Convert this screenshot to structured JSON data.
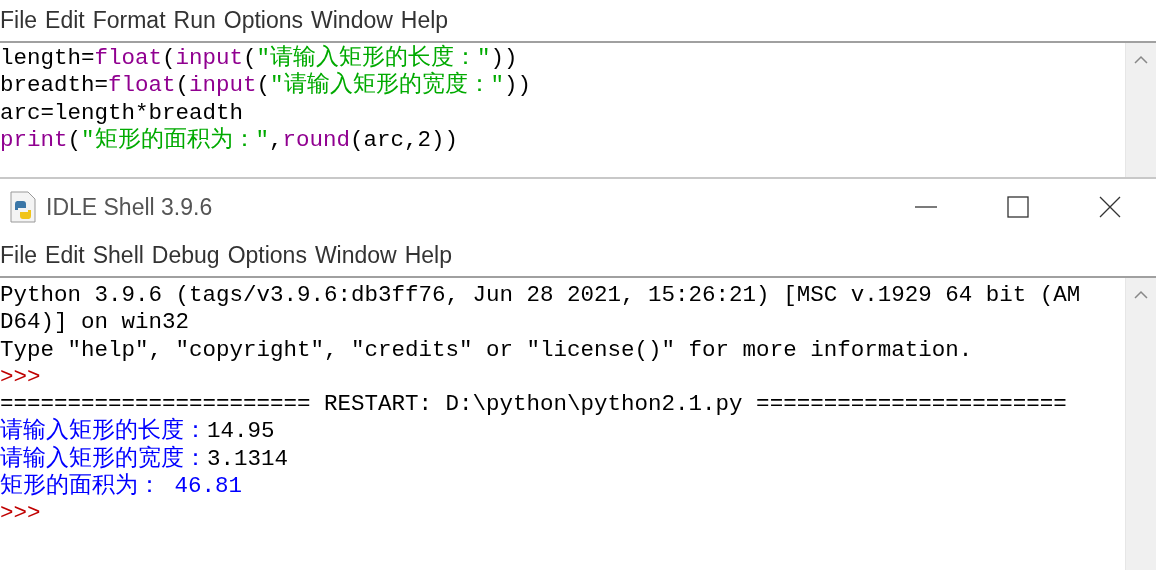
{
  "editor": {
    "menu": [
      "File",
      "Edit",
      "Format",
      "Run",
      "Options",
      "Window",
      "Help"
    ],
    "lines": [
      [
        {
          "kind": "plain",
          "text": "length="
        },
        {
          "kind": "builtin",
          "text": "float"
        },
        {
          "kind": "plain",
          "text": "("
        },
        {
          "kind": "builtin",
          "text": "input"
        },
        {
          "kind": "plain",
          "text": "("
        },
        {
          "kind": "string",
          "text": "\"请输入矩形的长度：\""
        },
        {
          "kind": "plain",
          "text": "))"
        }
      ],
      [
        {
          "kind": "plain",
          "text": "breadth="
        },
        {
          "kind": "builtin",
          "text": "float"
        },
        {
          "kind": "plain",
          "text": "("
        },
        {
          "kind": "builtin",
          "text": "input"
        },
        {
          "kind": "plain",
          "text": "("
        },
        {
          "kind": "string",
          "text": "\"请输入矩形的宽度：\""
        },
        {
          "kind": "plain",
          "text": "))"
        }
      ],
      [
        {
          "kind": "plain",
          "text": "arc=length*breadth"
        }
      ],
      [
        {
          "kind": "builtin",
          "text": "print"
        },
        {
          "kind": "plain",
          "text": "("
        },
        {
          "kind": "string",
          "text": "\"矩形的面积为：\""
        },
        {
          "kind": "plain",
          "text": ","
        },
        {
          "kind": "builtin",
          "text": "round"
        },
        {
          "kind": "plain",
          "text": "(arc,2))"
        }
      ]
    ]
  },
  "shell": {
    "window": {
      "title": "IDLE Shell 3.9.6"
    },
    "menu": [
      "File",
      "Edit",
      "Shell",
      "Debug",
      "Options",
      "Window",
      "Help"
    ],
    "lines": [
      [
        {
          "kind": "plain",
          "text": "Python 3.9.6 (tags/v3.9.6:db3ff76, Jun 28 2021, 15:26:21) [MSC v.1929 64 bit (AM"
        }
      ],
      [
        {
          "kind": "plain",
          "text": "D64)] on win32"
        }
      ],
      [
        {
          "kind": "plain",
          "text": "Type \"help\", \"copyright\", \"credits\" or \"license()\" for more information."
        }
      ],
      [
        {
          "kind": "prompt",
          "text": ">>>"
        }
      ],
      [
        {
          "kind": "plain",
          "text": "======================= RESTART: D:\\python\\python2.1.py ======================="
        }
      ],
      [
        {
          "kind": "stdout",
          "text": "请输入矩形的长度："
        },
        {
          "kind": "plain",
          "text": "14.95"
        }
      ],
      [
        {
          "kind": "stdout",
          "text": "请输入矩形的宽度："
        },
        {
          "kind": "plain",
          "text": "3.1314"
        }
      ],
      [
        {
          "kind": "stdout",
          "text": "矩形的面积为： 46.81"
        }
      ],
      [
        {
          "kind": "prompt",
          "text": ">>>"
        }
      ]
    ]
  }
}
